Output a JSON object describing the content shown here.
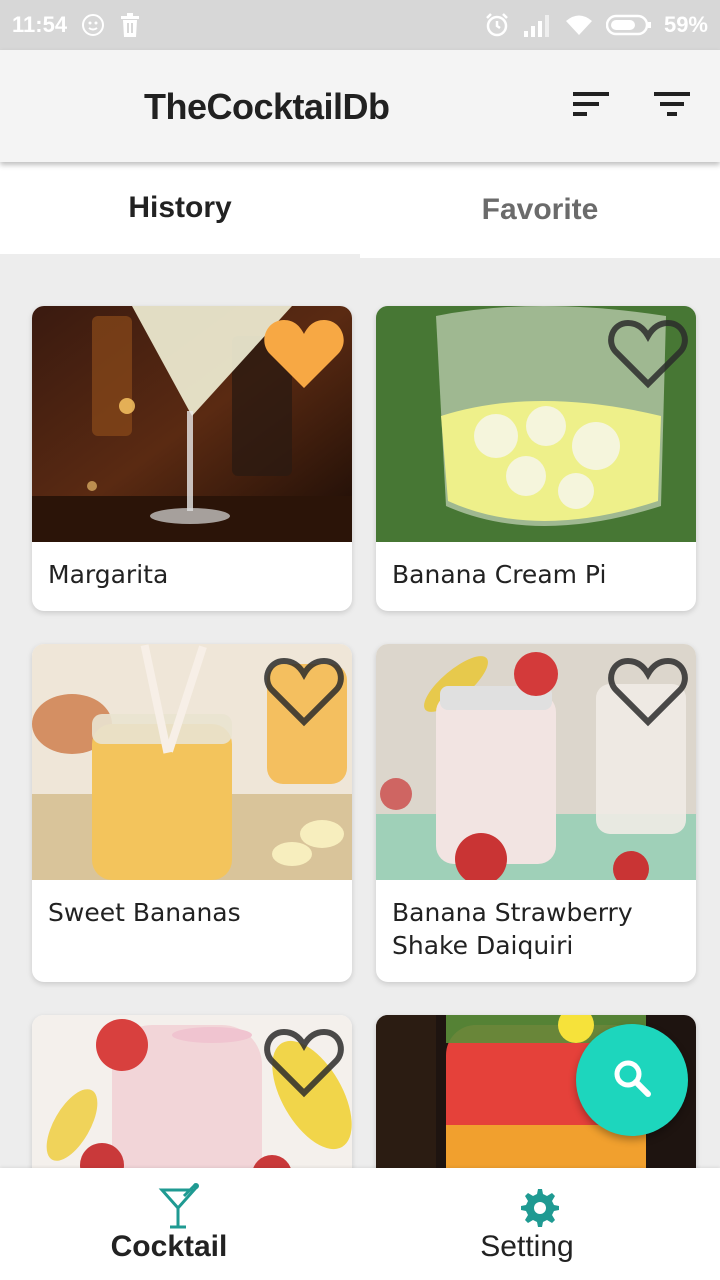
{
  "status_bar": {
    "time": "11:54",
    "battery": "59%"
  },
  "app_bar": {
    "title": "TheCocktailDb",
    "actions": [
      "sort-icon",
      "filter-icon"
    ]
  },
  "tabs": [
    {
      "label": "History",
      "selected": true
    },
    {
      "label": "Favorite",
      "selected": false
    }
  ],
  "drinks": [
    {
      "name": "Margarita",
      "favorite": true
    },
    {
      "name": "Banana Cream Pi",
      "favorite": false
    },
    {
      "name": "Sweet Bananas",
      "favorite": false
    },
    {
      "name": "Banana Strawberry Shake Daiquiri",
      "favorite": false
    },
    {
      "name": "",
      "favorite": false
    },
    {
      "name": "",
      "favorite": false
    }
  ],
  "fab": {
    "icon": "search-icon",
    "color": "#1dd6bd"
  },
  "bottom_nav": [
    {
      "label": "Cocktail",
      "icon": "cocktail-glass-icon",
      "selected": true
    },
    {
      "label": "Setting",
      "icon": "gear-icon",
      "selected": false
    }
  ],
  "colors": {
    "favorite_heart": "#f7a844",
    "accent": "#1dd6bd",
    "nav_icon": "#1f9a92"
  }
}
